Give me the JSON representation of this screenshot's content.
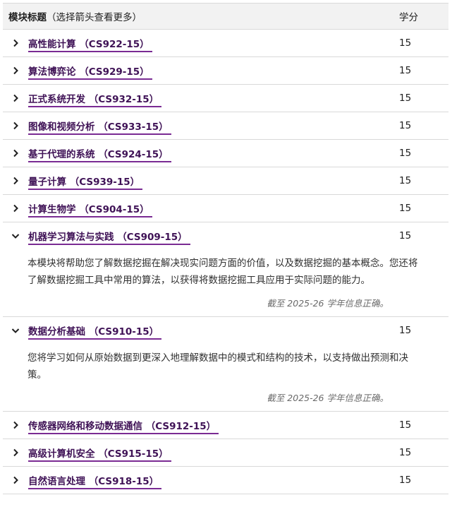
{
  "header": {
    "title_bold": "模块标题",
    "title_hint": "（选择箭头查看更多）",
    "credit_label": "学分"
  },
  "modules": [
    {
      "title": "高性能计算 （CS922-15）",
      "credit": "15",
      "expanded": false
    },
    {
      "title": "算法博弈论 （CS929-15）",
      "credit": "15",
      "expanded": false
    },
    {
      "title": "正式系统开发 （CS932-15）",
      "credit": "15",
      "expanded": false
    },
    {
      "title": "图像和视频分析 （CS933-15）",
      "credit": "15",
      "expanded": false
    },
    {
      "title": "基于代理的系统 （CS924-15）",
      "credit": "15",
      "expanded": false
    },
    {
      "title": "量子计算 （CS939-15）",
      "credit": "15",
      "expanded": false
    },
    {
      "title": "计算生物学 （CS904-15）",
      "credit": "15",
      "expanded": false
    },
    {
      "title": "机器学习算法与实践 （CS909-15）",
      "credit": "15",
      "expanded": true,
      "description": "本模块将帮助您了解数据挖掘在解决现实问题方面的价值，以及数据挖掘的基本概念。您还将了解数据挖掘工具中常用的算法，以获得将数据挖掘工具应用于实际问题的能力。",
      "note": "截至 2025-26 学年信息正确。"
    },
    {
      "title": "数据分析基础 （CS910-15）",
      "credit": "15",
      "expanded": true,
      "description": "您将学习如何从原始数据到更深入地理解数据中的模式和结构的技术，以支持做出预测和决策。",
      "note": "截至 2025-26 学年信息正确。"
    },
    {
      "title": "传感器网络和移动数据通信 （CS912-15）",
      "credit": "15",
      "expanded": false
    },
    {
      "title": "高级计算机安全 （CS915-15）",
      "credit": "15",
      "expanded": false
    },
    {
      "title": "自然语言处理 （CS918-15）",
      "credit": "15",
      "expanded": false
    }
  ]
}
